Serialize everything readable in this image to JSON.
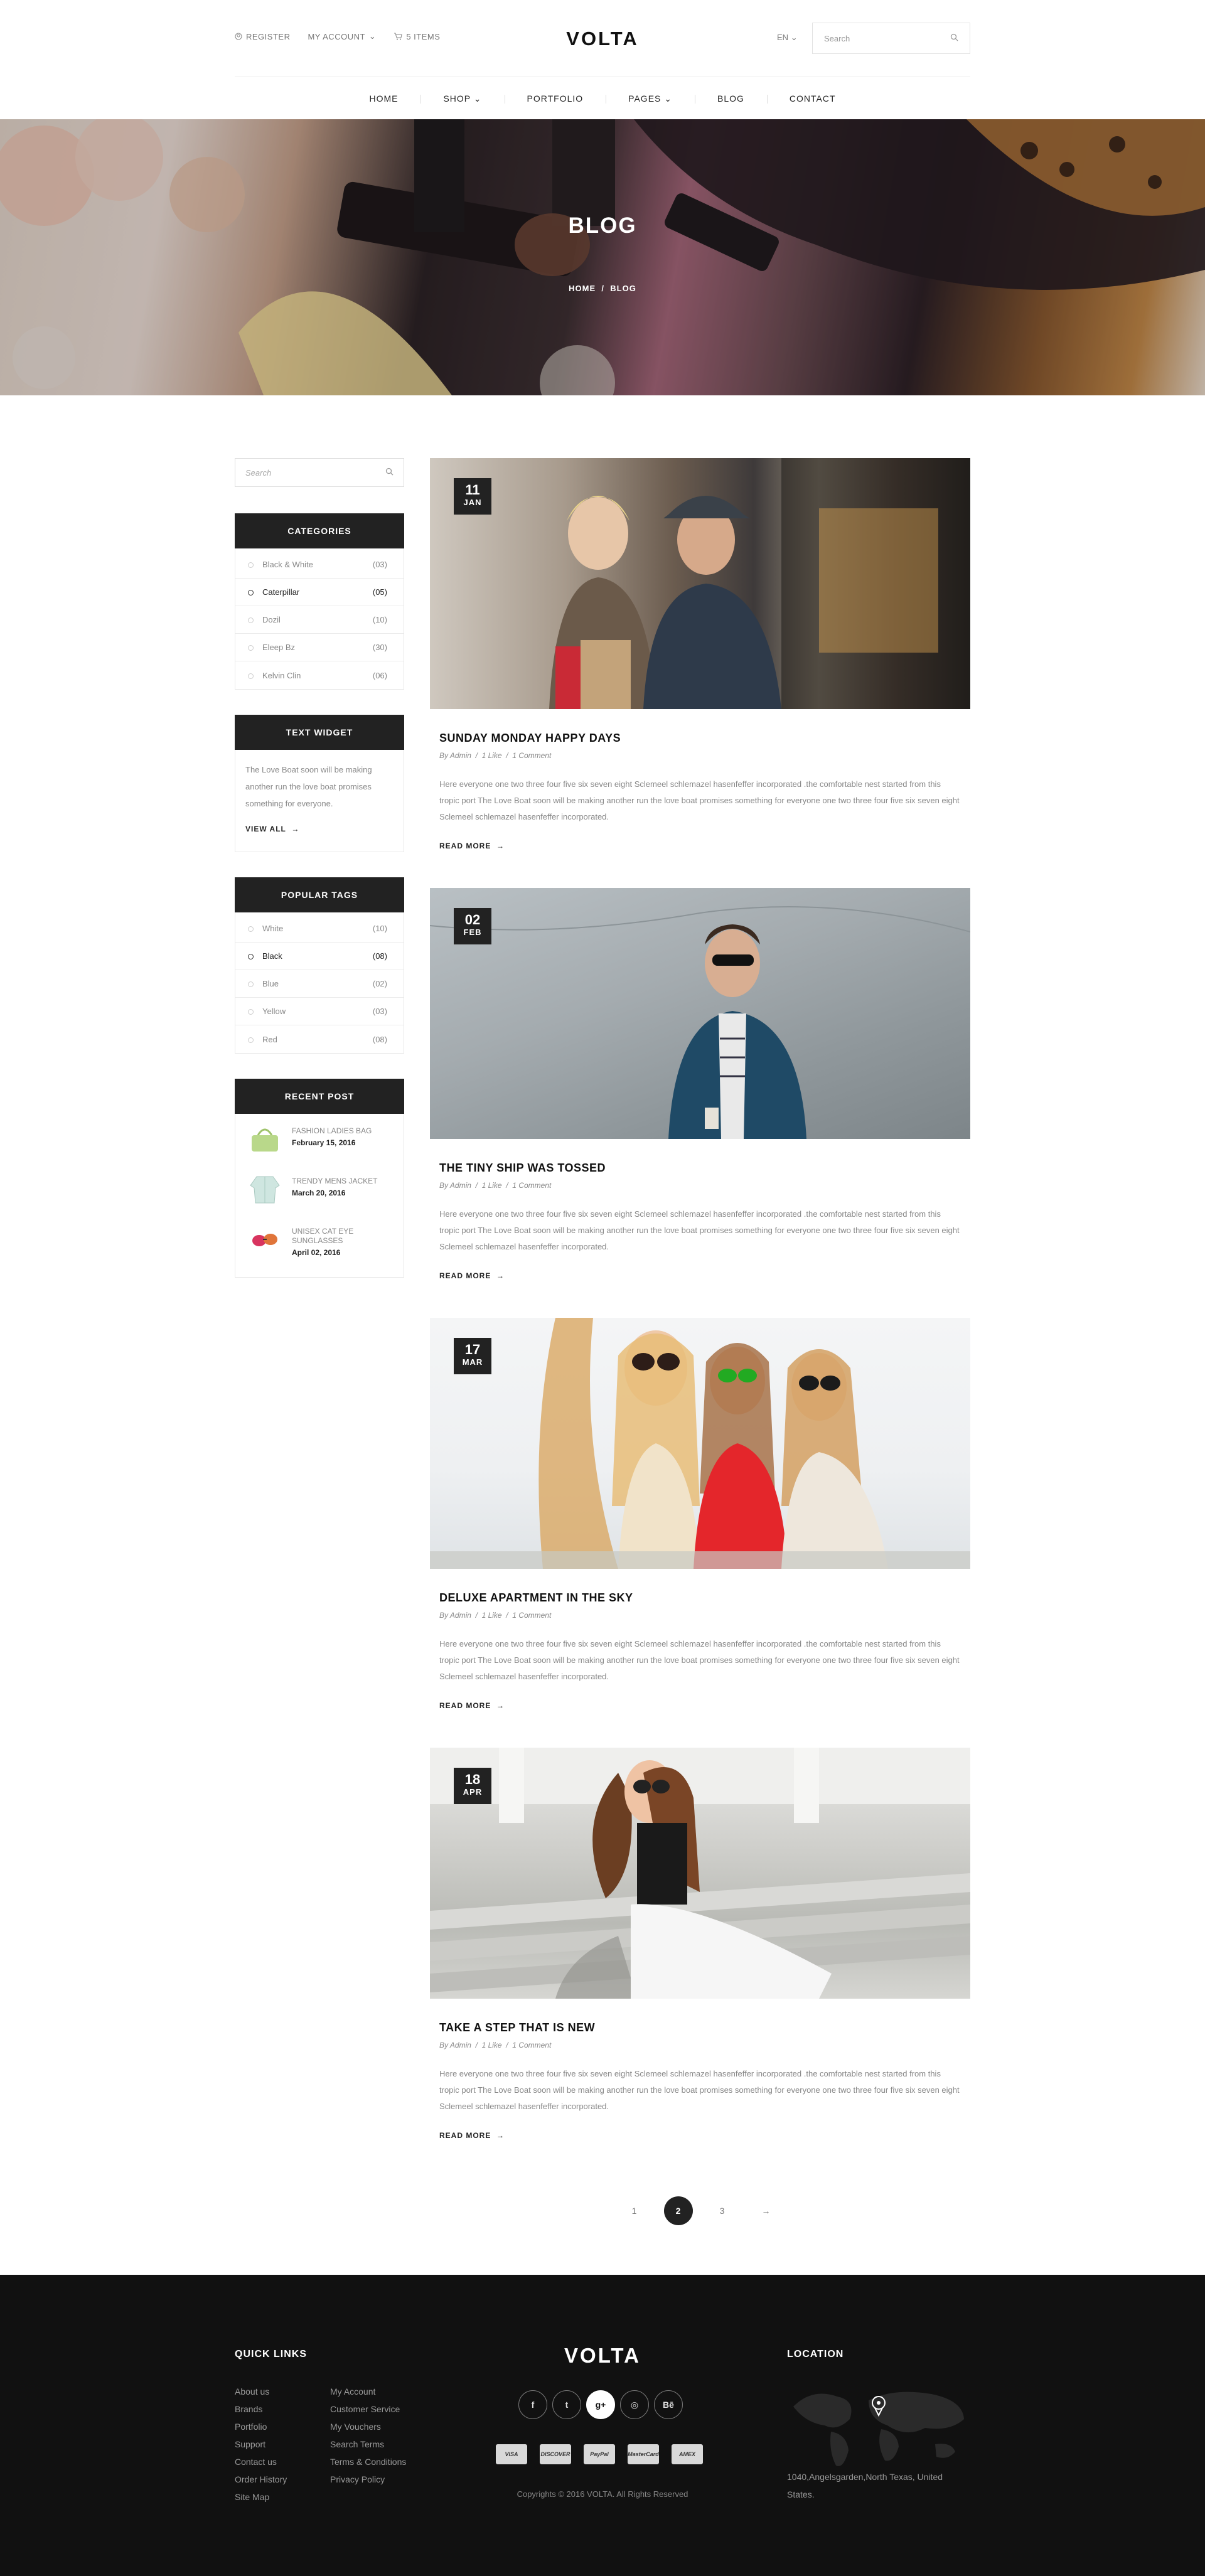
{
  "header": {
    "register_label": "REGISTER",
    "account_label": "MY ACCOUNT",
    "cart_label": "5 ITEMS",
    "logo": "VOLTA",
    "language": "EN",
    "search_placeholder": "Search"
  },
  "nav": {
    "items": [
      {
        "label": "HOME",
        "dropdown": false
      },
      {
        "label": "SHOP",
        "dropdown": true
      },
      {
        "label": "PORTFOLIO",
        "dropdown": false
      },
      {
        "label": "PAGES",
        "dropdown": true
      },
      {
        "label": "BLOG",
        "dropdown": false
      },
      {
        "label": "CONTACT",
        "dropdown": false
      }
    ]
  },
  "hero": {
    "title": "BLOG",
    "breadcrumb": [
      "HOME",
      "BLOG"
    ],
    "separator": "/"
  },
  "sidebar": {
    "search_placeholder": "Search",
    "categories": {
      "title": "CATEGORIES",
      "items": [
        {
          "label": "Black & White",
          "count": "(03)",
          "active": false
        },
        {
          "label": "Caterpillar",
          "count": "(05)",
          "active": true
        },
        {
          "label": "Dozil",
          "count": "(10)",
          "active": false
        },
        {
          "label": "Eleep Bz",
          "count": "(30)",
          "active": false
        },
        {
          "label": "Kelvin Clin",
          "count": "(06)",
          "active": false
        }
      ]
    },
    "text_widget": {
      "title": "TEXT WIDGET",
      "body": "The Love Boat soon will be making another run the love boat promises something for everyone.",
      "link": "VIEW ALL"
    },
    "tags": {
      "title": "POPULAR TAGS",
      "items": [
        {
          "label": "White",
          "count": "(10)",
          "active": false
        },
        {
          "label": "Black",
          "count": "(08)",
          "active": true
        },
        {
          "label": "Blue",
          "count": "(02)",
          "active": false
        },
        {
          "label": "Yellow",
          "count": "(03)",
          "active": false
        },
        {
          "label": "Red",
          "count": "(08)",
          "active": false
        }
      ]
    },
    "recent": {
      "title": "RECENT POST",
      "items": [
        {
          "title": "FASHION LADIES BAG",
          "date": "February 15, 2016",
          "thumb": "bag-thumbnail",
          "color": "#b9d88a"
        },
        {
          "title": "TRENDY MENS JACKET",
          "date": "March 20, 2016",
          "thumb": "jacket-thumbnail",
          "color": "#cfe6e0"
        },
        {
          "title": "UNISEX CAT EYE SUNGLASSES",
          "date": "April 02, 2016",
          "thumb": "sunglasses-thumbnail",
          "color": "#d8345f"
        }
      ]
    }
  },
  "posts": [
    {
      "day": "11",
      "month": "JAN",
      "title": "SUNDAY MONDAY HAPPY DAYS",
      "author": "By Admin",
      "likes": "1 Like",
      "comments": "1 Comment",
      "excerpt": "Here everyone one two three four five six seven eight Sclemeel schlemazel hasenfeffer incorporated .the comfortable nest started from this tropic port The Love Boat soon will be making another run the love boat promises something for everyone one two three four five six seven eight Sclemeel schlemazel hasenfeffer incorporated.",
      "read_more": "READ MORE",
      "image": "couple-shopping-photo"
    },
    {
      "day": "02",
      "month": "FEB",
      "title": "THE TINY SHIP WAS TOSSED",
      "author": "By Admin",
      "likes": "1 Like",
      "comments": "1 Comment",
      "excerpt": "Here everyone one two three four five six seven eight Sclemeel schlemazel hasenfeffer incorporated .the comfortable nest started from this tropic port The Love Boat soon will be making another run the love boat promises something for everyone one two three four five six seven eight Sclemeel schlemazel hasenfeffer incorporated.",
      "read_more": "READ MORE",
      "image": "man-blazer-photo"
    },
    {
      "day": "17",
      "month": "MAR",
      "title": "DELUXE APARTMENT IN THE SKY",
      "author": "By Admin",
      "likes": "1 Like",
      "comments": "1 Comment",
      "excerpt": "Here everyone one two three four five six seven eight Sclemeel schlemazel hasenfeffer incorporated .the comfortable nest started from this tropic port The Love Boat soon will be making another run the love boat promises something for everyone one two three four five six seven eight Sclemeel schlemazel hasenfeffer incorporated.",
      "read_more": "READ MORE",
      "image": "three-women-sunglasses-photo"
    },
    {
      "day": "18",
      "month": "APR",
      "title": "TAKE A STEP THAT IS NEW",
      "author": "By Admin",
      "likes": "1 Like",
      "comments": "1 Comment",
      "excerpt": "Here everyone one two three four five six seven eight Sclemeel schlemazel hasenfeffer incorporated .the comfortable nest started from this tropic port The Love Boat soon will be making another run the love boat promises something for everyone one two three four five six seven eight Sclemeel schlemazel hasenfeffer incorporated.",
      "read_more": "READ MORE",
      "image": "woman-on-steps-photo"
    }
  ],
  "pagination": {
    "pages": [
      "1",
      "2",
      "3"
    ],
    "current": "2",
    "next": "→"
  },
  "footer": {
    "quick_links_title": "QUICK LINKS",
    "links_col1": [
      "About us",
      "Brands",
      "Portfolio",
      "Support",
      "Contact us",
      "Order History",
      "Site Map"
    ],
    "links_col2": [
      "My Account",
      "Customer Service",
      "My Vouchers",
      "Search Terms",
      "Terms & Conditions",
      "Privacy Policy"
    ],
    "logo": "VOLTA",
    "social": [
      {
        "icon": "facebook-icon",
        "glyph": "f"
      },
      {
        "icon": "twitter-icon",
        "glyph": "t"
      },
      {
        "icon": "google-plus-icon",
        "glyph": "g+"
      },
      {
        "icon": "instagram-icon",
        "glyph": "◎"
      },
      {
        "icon": "behance-icon",
        "glyph": "Bē"
      }
    ],
    "payments": [
      "VISA",
      "DISCOVER",
      "PayPal",
      "MasterCard",
      "AMEX"
    ],
    "copyright": "Copyrights © 2016 VOLTA. All Rights Reserved",
    "location_title": "LOCATION",
    "address": "1040,Angelsgarden,North Texas, United States."
  },
  "colors": {
    "accent": "#222222",
    "footer_bg": "#111111",
    "text_muted": "#888888"
  }
}
